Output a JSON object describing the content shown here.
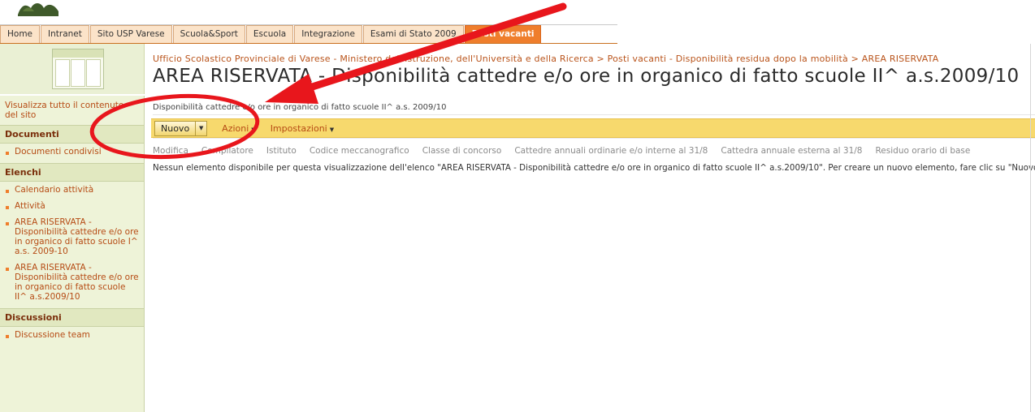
{
  "nav": {
    "tabs": [
      {
        "label": "Home"
      },
      {
        "label": "Intranet"
      },
      {
        "label": "Sito USP Varese"
      },
      {
        "label": "Scuola&Sport"
      },
      {
        "label": "Escuola"
      },
      {
        "label": "Integrazione"
      },
      {
        "label": "Esami di Stato 2009"
      },
      {
        "label": "Posti vacanti"
      }
    ],
    "active_color": "#ef7e2c"
  },
  "header": {
    "breadcrumb": "Ufficio Scolastico Provinciale di Varese - Ministero dell'Istruzione, dell'Università e della Ricerca > Posti vacanti - Disponibilità residua dopo la mobilità > AREA RISERVATA",
    "title": "AREA RISERVATA - Disponibilità cattedre e/o ore in organico di fatto scuole II^ a.s.2009/10"
  },
  "sidebar": {
    "view_all": "Visualizza tutto il contenuto del sito",
    "sections": [
      {
        "heading": "Documenti",
        "items": [
          "Documenti condivisi"
        ]
      },
      {
        "heading": "Elenchi",
        "items": [
          "Calendario attività",
          "Attività",
          "AREA RISERVATA - Disponibilità cattedre e/o ore in organico di fatto scuole I^ a.s. 2009-10",
          "AREA RISERVATA - Disponibilità cattedre e/o ore in organico di fatto scuole II^ a.s.2009/10"
        ]
      },
      {
        "heading": "Discussioni",
        "items": [
          "Discussione team"
        ]
      }
    ]
  },
  "list": {
    "title": "Disponibilità cattedre e/o ore in organico di fatto scuole II^ a.s. 2009/10",
    "toolbar": {
      "new_label": "Nuovo",
      "actions_label": "Azioni",
      "settings_label": "Impostazioni"
    },
    "columns": [
      "Modifica",
      "Compilatore",
      "Istituto",
      "Codice meccanografico",
      "Classe di concorso",
      "Cattedre annuali ordinarie e/o interne al 31/8",
      "Cattedra annuale esterna al 31/8",
      "Residuo orario di base"
    ],
    "empty_message": "Nessun elemento disponibile per questa visualizzazione dell'elenco \"AREA RISERVATA - Disponibilità cattedre e/o ore in organico di fatto scuole II^ a.s.2009/10\". Per creare un nuovo elemento, fare clic su \"Nuovo\"."
  },
  "annotation": {
    "arrow_color": "#e8161c",
    "ellipse_color": "#e8161c"
  }
}
